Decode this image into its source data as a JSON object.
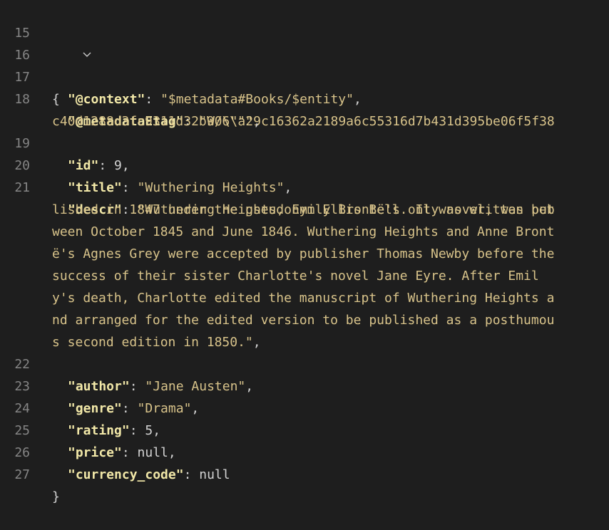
{
  "editor": {
    "lines": [
      {
        "num": "15"
      },
      {
        "num": "16",
        "open": "{"
      },
      {
        "num": "17",
        "key": "\"@context\"",
        "value": "\"$metadata#Books/$entity\"",
        "end": ","
      },
      {
        "num": "18",
        "key": "\"@metadataEtag\"",
        "value": "\"W/\\\"a29c16362a2189a6c55316d7b431d395be06f5f38",
        "cont": "c40d1288d3fc9311d32b906\\\"\"",
        "end": ","
      },
      {
        "num": "19",
        "key": "\"id\"",
        "value": "9",
        "end": ","
      },
      {
        "num": "20",
        "key": "\"title\"",
        "value": "\"Wuthering Heights\"",
        "end": ","
      },
      {
        "num": "21",
        "key": "\"descr\"",
        "value": "\"Wuthering Heights, Emily Brontë's only novel, was pub",
        "wraps": [
          "lished in 1847 under the pseudonym Ellis Bell. It was written bet",
          "ween October 1845 and June 1846. Wuthering Heights and Anne Bront",
          "ë's Agnes Grey were accepted by publisher Thomas Newby before the",
          "success of their sister Charlotte's novel Jane Eyre. After Emil",
          "y's death, Charlotte edited the manuscript of Wuthering Heights a",
          "nd arranged for the edited version to be published as a posthumou",
          "s second edition in 1850.\""
        ],
        "end": ","
      },
      {
        "num": "22",
        "key": "\"author\"",
        "value": "\"Jane Austen\"",
        "end": ","
      },
      {
        "num": "23",
        "key": "\"genre\"",
        "value": "\"Drama\"",
        "end": ","
      },
      {
        "num": "24",
        "key": "\"rating\"",
        "value": "5",
        "end": ","
      },
      {
        "num": "25",
        "key": "\"price\"",
        "value": "null",
        "end": ","
      },
      {
        "num": "26",
        "key": "\"currency_code\"",
        "value": "null",
        "end": ""
      },
      {
        "num": "27",
        "close": "}"
      }
    ],
    "fold_icon": "chevron-down-icon",
    "colors": {
      "background": "#1e1e1e",
      "line_number": "#858585",
      "key": "#f2e8a8",
      "string": "#d8c38a",
      "punctuation": "#d4d4d4"
    }
  }
}
